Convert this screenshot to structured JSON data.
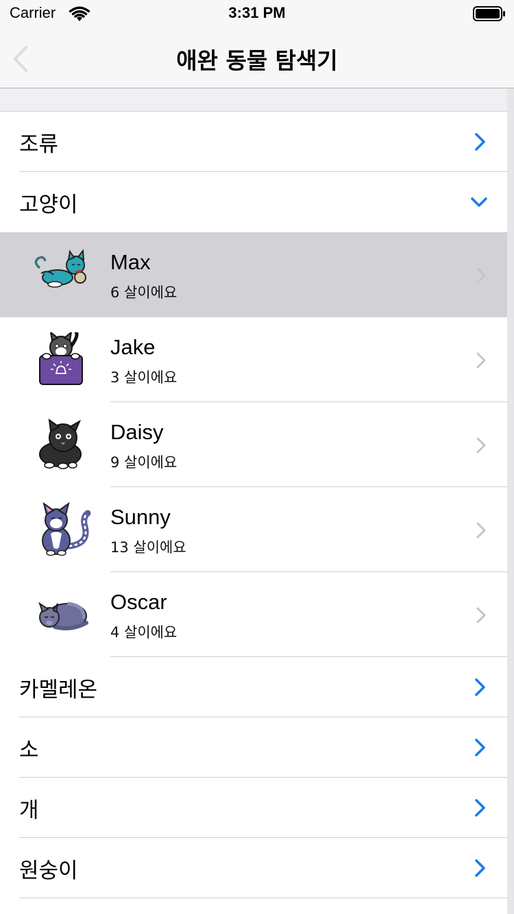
{
  "status_bar": {
    "carrier": "Carrier",
    "time": "3:31 PM"
  },
  "nav": {
    "title": "애완 동물 탐색기",
    "back_icon": "chevron-left-icon"
  },
  "categories_top": [
    {
      "label": "조류",
      "state": "collapsed"
    },
    {
      "label": "고양이",
      "state": "expanded"
    }
  ],
  "pets": [
    {
      "name": "Max",
      "age": "6 살이에요",
      "selected": true,
      "icon": "cat-teal-icon"
    },
    {
      "name": "Jake",
      "age": "3 살이에요",
      "selected": false,
      "icon": "cat-box-icon"
    },
    {
      "name": "Daisy",
      "age": "9 살이에요",
      "selected": false,
      "icon": "cat-black-icon"
    },
    {
      "name": "Sunny",
      "age": "13 살이에요",
      "selected": false,
      "icon": "cat-sitting-icon"
    },
    {
      "name": "Oscar",
      "age": "4 살이에요",
      "selected": false,
      "icon": "cat-sleeping-icon"
    }
  ],
  "categories_bottom": [
    {
      "label": "카멜레온",
      "state": "collapsed"
    },
    {
      "label": "소",
      "state": "collapsed"
    },
    {
      "label": "개",
      "state": "collapsed"
    },
    {
      "label": "원숭이",
      "state": "collapsed"
    }
  ],
  "colors": {
    "accent": "#1a7cf0",
    "selected_row": "#d1d1d6",
    "separator": "#cfcfd3",
    "disclosure": "#c4c4c8"
  }
}
